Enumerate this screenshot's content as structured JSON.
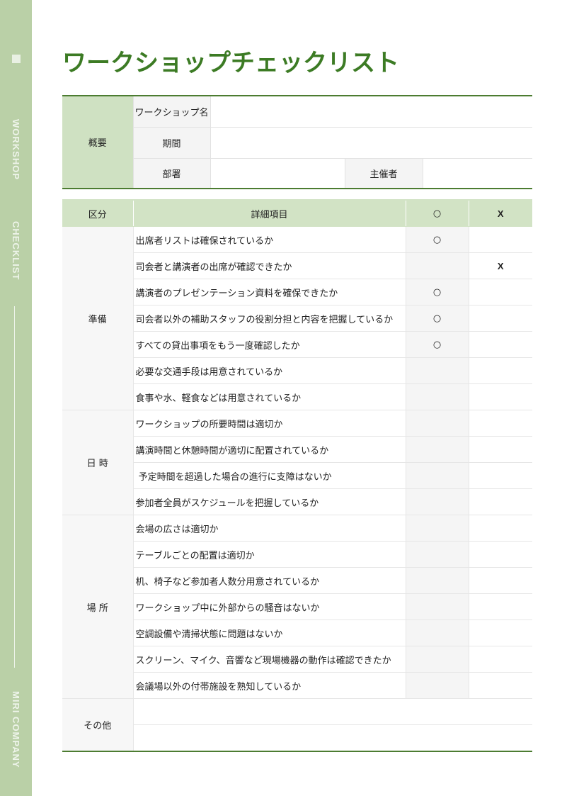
{
  "sidebar": {
    "labels": [
      "WORKSHOP",
      "CHECKLIST",
      "MIRI COMPANY"
    ]
  },
  "title": "ワークショップチェックリスト",
  "overview": {
    "section_label": "概要",
    "workshop_name_label": "ワークショップ名",
    "workshop_name_value": "",
    "period_label": "期間",
    "period_value": "",
    "department_label": "部署",
    "department_value": "",
    "organizer_label": "主催者",
    "organizer_value": ""
  },
  "checklist": {
    "headers": {
      "category": "区分",
      "detail": "詳細項目",
      "ok": "○",
      "ng": "X"
    },
    "groups": [
      {
        "category": "準備",
        "items": [
          {
            "text": "出席者リストは確保されているか",
            "ok": "○",
            "ng": ""
          },
          {
            "text": "司会者と講演者の出席が確認できたか",
            "ok": "",
            "ng": "X"
          },
          {
            "text": "講演者のプレゼンテーション資料を確保できたか",
            "ok": "○",
            "ng": ""
          },
          {
            "text": "司会者以外の補助スタッフの役割分担と内容を把握しているか",
            "ok": "○",
            "ng": ""
          },
          {
            "text": "すべての貸出事項をもう一度確認したか",
            "ok": "○",
            "ng": ""
          },
          {
            "text": "必要な交通手段は用意されているか",
            "ok": "",
            "ng": ""
          },
          {
            "text": "食事や水、軽食などは用意されているか",
            "ok": "",
            "ng": ""
          }
        ]
      },
      {
        "category": "日 時",
        "items": [
          {
            "text": "ワークショップの所要時間は適切か",
            "ok": "",
            "ng": ""
          },
          {
            "text": "講演時間と休憩時間が適切に配置されているか",
            "ok": "",
            "ng": ""
          },
          {
            "text": " 予定時間を超過した場合の進行に支障はないか",
            "ok": "",
            "ng": ""
          },
          {
            "text": "参加者全員がスケジュールを把握しているか",
            "ok": "",
            "ng": ""
          }
        ]
      },
      {
        "category": "場 所",
        "items": [
          {
            "text": "会場の広さは適切か",
            "ok": "",
            "ng": ""
          },
          {
            "text": "テーブルごとの配置は適切か",
            "ok": "",
            "ng": ""
          },
          {
            "text": "机、椅子など参加者人数分用意されているか",
            "ok": "",
            "ng": ""
          },
          {
            "text": "ワークショップ中に外部からの騒音はないか",
            "ok": "",
            "ng": ""
          },
          {
            "text": "空調設備や清掃状態に問題はないか",
            "ok": "",
            "ng": ""
          },
          {
            "text": "スクリーン、マイク、音響など現場機器の動作は確認できたか",
            "ok": "",
            "ng": ""
          },
          {
            "text": "会議場以外の付帯施設を熟知しているか",
            "ok": "",
            "ng": ""
          }
        ]
      }
    ],
    "other": {
      "category": "その他",
      "rows": [
        "",
        ""
      ]
    }
  },
  "colors": {
    "accent": "#3c7b24",
    "rule": "#4c7c31",
    "sidebar": "#bad0a7",
    "header_bg": "#d2e3c5"
  }
}
